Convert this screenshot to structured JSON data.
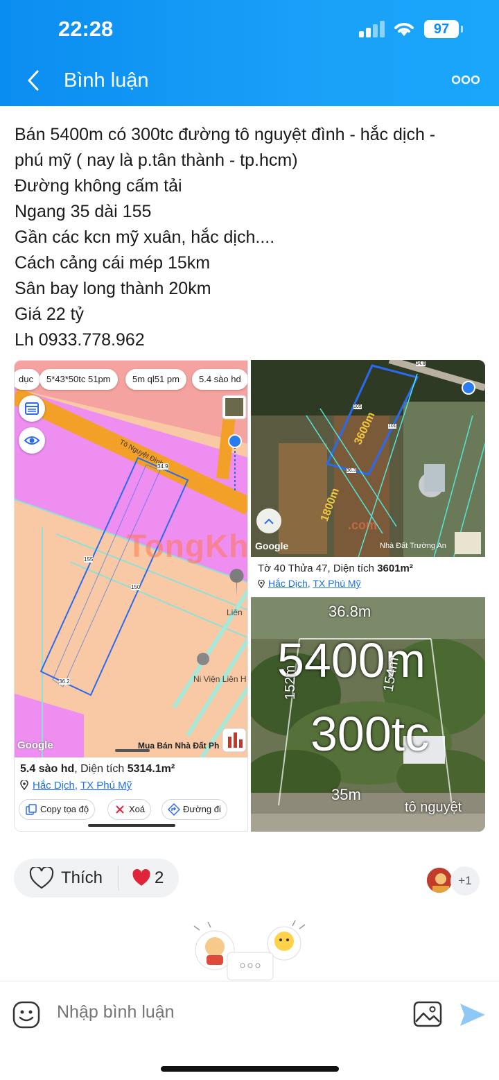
{
  "status_bar": {
    "time": "22:28",
    "battery": "97"
  },
  "header": {
    "title": "Bình luận"
  },
  "post": {
    "lines": [
      "Bán 5400m có 300tc đường tô nguyệt đình - hắc dịch -",
      "phú mỹ ( nay là p.tân thành - tp.hcm)",
      "Đường không cấm tải",
      "Ngang 35 dài 155",
      "Gần các kcn mỹ xuân, hắc dịch....",
      "Cách cảng cái mép 15km",
      "Sân bay long thành 20km",
      "Giá 22 tỷ",
      "Lh 0933.778.962"
    ]
  },
  "map_image": {
    "chips": [
      "dục",
      "5*43*50tc 51pm",
      "5m ql51 pm",
      "5.4 sào hd"
    ],
    "road_label": "Tô Nguyệt Đình",
    "plot_labels": [
      "34.9",
      "155",
      "150",
      "36.2"
    ],
    "poi_1": "Liên",
    "poi_2": "Ni Viện Liên H",
    "google": "Google",
    "watermark": "Mua Bán Nhà Đất Ph",
    "tong_kho": "TongKhoBDS",
    "card_title_bold": "5.4 sào hd",
    "card_title_rest": ", Diện tích ",
    "card_area": "5314.1m²",
    "loc_1": "Hắc Dịch",
    "loc_sep": ", ",
    "loc_2": "TX Phú Mỹ",
    "actions": [
      "Copy tọa độ",
      "Xoá",
      "Đường đi"
    ]
  },
  "aerial_image": {
    "labels": [
      "3600m",
      "1800m",
      "34.8",
      "105",
      "101",
      "36.3"
    ],
    "google": "Google",
    "credit": "Nhà Đất Trường An",
    "com": ".com",
    "card_text": "Tờ 40 Thửa 47, Diện tích ",
    "card_area": "3601m²",
    "loc_1": "Hắc Dịch",
    "loc_sep": ", ",
    "loc_2": "TX Phú Mỹ"
  },
  "photo_image": {
    "big_1": "5400m",
    "big_2": "300tc",
    "top": "36.8m",
    "left": "152m",
    "right": "154m",
    "bottom": "35m",
    "road": "tô nguyệt"
  },
  "reactions": {
    "like_label": "Thích",
    "heart_count": "2",
    "more_count": "+1"
  },
  "composer": {
    "placeholder": "Nhập bình luận"
  },
  "colors": {
    "header": "#1a9bf5",
    "link": "#1a73e8",
    "heart": "#e0243a"
  }
}
